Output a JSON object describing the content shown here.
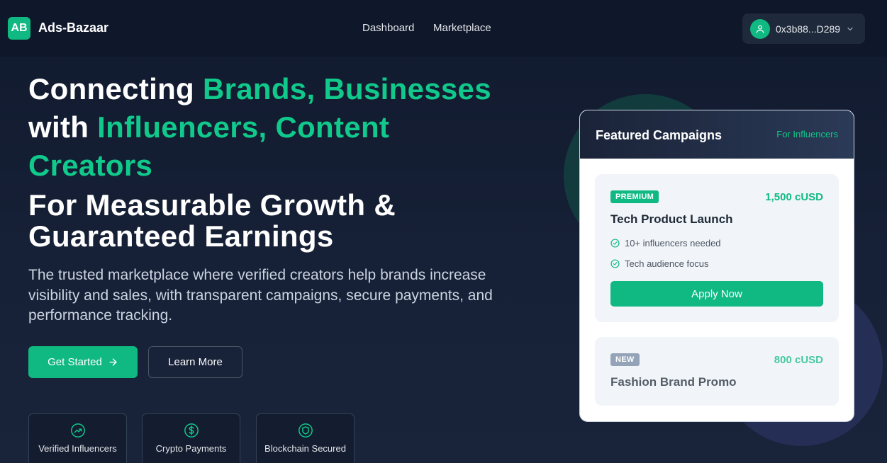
{
  "brand": {
    "logo_initials": "AB",
    "name": "Ads-Bazaar",
    "accent": "#10b981"
  },
  "nav": {
    "items": [
      {
        "label": "Dashboard"
      },
      {
        "label": "Marketplace"
      }
    ]
  },
  "wallet": {
    "address": "0x3b88...D289",
    "icon": "user-icon"
  },
  "hero": {
    "line1_white": "Connecting ",
    "line1_green": "Brands, Businesses",
    "line2_white": "with ",
    "line2_green": "Influencers, Content",
    "line3_green": "Creators",
    "line4": "For Measurable Growth &",
    "line5": "Guaranteed Earnings",
    "subtitle": "The trusted marketplace where verified creators help brands increase visibility and sales, with transparent campaigns, secure payments, and performance tracking."
  },
  "actions": {
    "primary": "Get Started",
    "secondary": "Learn More"
  },
  "features": [
    {
      "icon": "trending-up-icon",
      "label": "Verified Influencers"
    },
    {
      "icon": "dollar-icon",
      "label": "Crypto Payments"
    },
    {
      "icon": "shield-icon",
      "label": "Blockchain Secured"
    }
  ],
  "featured": {
    "title": "Featured Campaigns",
    "tag": "For Influencers",
    "campaigns": [
      {
        "badge": "PREMIUM",
        "badge_color": "#10b981",
        "price": "1,500 cUSD",
        "name": "Tech Product Launch",
        "requirements": [
          "10+ influencers needed",
          "Tech audience focus"
        ],
        "cta": "Apply Now"
      },
      {
        "badge": "NEW",
        "badge_color": "#64748b",
        "price": "800 cUSD",
        "name": "Fashion Brand Promo"
      }
    ]
  }
}
